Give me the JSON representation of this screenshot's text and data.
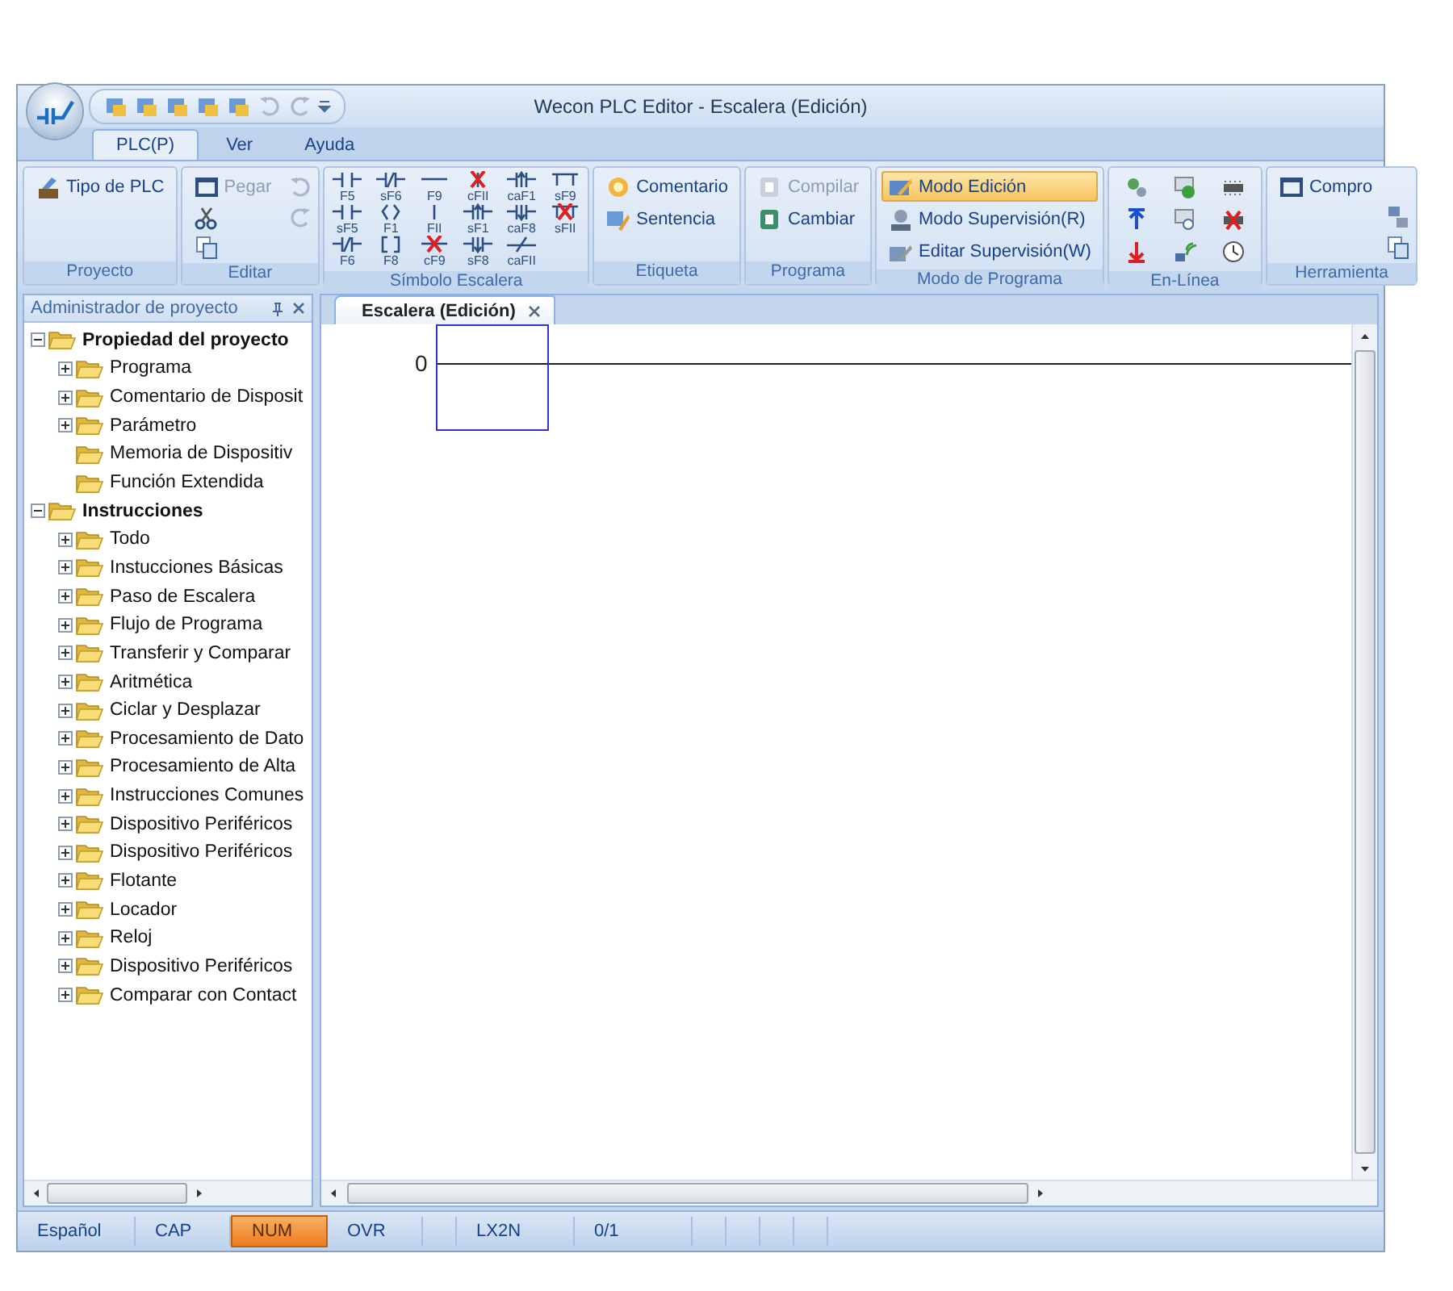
{
  "window": {
    "title": "Wecon PLC Editor - Escalera (Edición)"
  },
  "ribbon_tabs": [
    {
      "label": "PLC(P)",
      "selected": true
    },
    {
      "label": "Ver",
      "selected": false
    },
    {
      "label": "Ayuda",
      "selected": false
    }
  ],
  "ribbon_groups": [
    {
      "title": "Proyecto",
      "kind": "buttons",
      "items": [
        {
          "label": "Tipo de PLC",
          "disabled": false,
          "selected": false
        }
      ]
    },
    {
      "title": "Editar",
      "kind": "edit",
      "items": [
        {
          "label": "Pegar",
          "disabled": true,
          "selected": false
        }
      ]
    },
    {
      "title": "Símbolo Escalera",
      "kind": "symbols",
      "symbols": [
        {
          "key": "F5",
          "kind": "contact",
          "deleted": false
        },
        {
          "key": "sF6",
          "kind": "negated",
          "deleted": false
        },
        {
          "key": "F9",
          "kind": "hline",
          "deleted": false
        },
        {
          "key": "cFII",
          "kind": "vline",
          "deleted": true
        },
        {
          "key": "caF1",
          "kind": "rising",
          "deleted": false
        },
        {
          "key": "sF9",
          "kind": "instruction",
          "deleted": false
        },
        {
          "key": "sF5",
          "kind": "contact",
          "deleted": false
        },
        {
          "key": "F1",
          "kind": "coil",
          "deleted": false
        },
        {
          "key": "FII",
          "kind": "vline",
          "deleted": false
        },
        {
          "key": "sF1",
          "kind": "rising",
          "deleted": false
        },
        {
          "key": "caF8",
          "kind": "falling",
          "deleted": false
        },
        {
          "key": "sFII",
          "kind": "instruction",
          "deleted": true
        },
        {
          "key": "F6",
          "kind": "negated",
          "deleted": false
        },
        {
          "key": "F8",
          "kind": "function",
          "deleted": false
        },
        {
          "key": "cF9",
          "kind": "hline",
          "deleted": true
        },
        {
          "key": "sF8",
          "kind": "falling",
          "deleted": false
        },
        {
          "key": "caFII",
          "kind": "invert",
          "deleted": false
        }
      ]
    },
    {
      "title": "Etiqueta",
      "kind": "buttons",
      "items": [
        {
          "label": "Comentario",
          "disabled": false,
          "selected": false
        },
        {
          "label": "Sentencia",
          "disabled": false,
          "selected": false
        }
      ]
    },
    {
      "title": "Programa",
      "kind": "buttons",
      "items": [
        {
          "label": "Compilar",
          "disabled": true,
          "selected": false
        },
        {
          "label": "Cambiar",
          "disabled": false,
          "selected": false
        }
      ]
    },
    {
      "title": "Modo de Programa",
      "kind": "buttons",
      "items": [
        {
          "label": "Modo Edición",
          "disabled": false,
          "selected": true
        },
        {
          "label": "Modo Supervisión(R)",
          "disabled": false,
          "selected": false
        },
        {
          "label": "Editar Supervisión(W)",
          "disabled": false,
          "selected": false
        }
      ]
    },
    {
      "title": "En-Línea",
      "kind": "online"
    },
    {
      "title": "Herramienta",
      "kind": "buttons",
      "items": [
        {
          "label": "Compro",
          "disabled": false,
          "selected": false
        }
      ]
    }
  ],
  "project_panel": {
    "title": "Administrador de proyecto",
    "tree": [
      {
        "label": "Propiedad del proyecto",
        "kind": "expanded",
        "children": [
          {
            "label": "Programa",
            "kind": "collapsed"
          },
          {
            "label": "Comentario de Disposit",
            "kind": "collapsed"
          },
          {
            "label": "Parámetro",
            "kind": "collapsed"
          },
          {
            "label": "Memoria de Dispositiv",
            "kind": "leaf"
          },
          {
            "label": "Función Extendida",
            "kind": "leaf"
          }
        ]
      },
      {
        "label": "Instrucciones",
        "kind": "expanded",
        "children": [
          {
            "label": "Todo",
            "kind": "collapsed"
          },
          {
            "label": "Instucciones Básicas",
            "kind": "collapsed"
          },
          {
            "label": "Paso de Escalera",
            "kind": "collapsed"
          },
          {
            "label": "Flujo de Programa",
            "kind": "collapsed"
          },
          {
            "label": "Transferir y Comparar",
            "kind": "collapsed"
          },
          {
            "label": "Aritmética",
            "kind": "collapsed"
          },
          {
            "label": "Ciclar y Desplazar",
            "kind": "collapsed"
          },
          {
            "label": "Procesamiento de Dato",
            "kind": "collapsed"
          },
          {
            "label": "Procesamiento de Alta",
            "kind": "collapsed"
          },
          {
            "label": "Instrucciones Comunes",
            "kind": "collapsed"
          },
          {
            "label": "Dispositivo Periféricos",
            "kind": "collapsed"
          },
          {
            "label": "Dispositivo Periféricos",
            "kind": "collapsed"
          },
          {
            "label": "Flotante",
            "kind": "collapsed"
          },
          {
            "label": "Locador",
            "kind": "collapsed"
          },
          {
            "label": "Reloj",
            "kind": "collapsed"
          },
          {
            "label": "Dispositivo Periféricos",
            "kind": "collapsed"
          },
          {
            "label": "Comparar con Contact",
            "kind": "collapsed"
          }
        ]
      }
    ]
  },
  "editor": {
    "tabs": [
      {
        "label": "Escalera (Edición)",
        "selected": true
      }
    ],
    "rungs": [
      {
        "step": "0"
      }
    ]
  },
  "status_bar": [
    {
      "kind": "text",
      "text": "Español"
    },
    {
      "kind": "indicator",
      "text": "CAP",
      "on": false
    },
    {
      "kind": "indicator",
      "text": "NUM",
      "on": true
    },
    {
      "kind": "indicator",
      "text": "OVR",
      "on": false
    },
    {
      "kind": "blank"
    },
    {
      "kind": "text",
      "text": "LX2N"
    },
    {
      "kind": "text",
      "text": "0/1"
    },
    {
      "kind": "blank"
    },
    {
      "kind": "blank"
    },
    {
      "kind": "blank"
    },
    {
      "kind": "blank"
    }
  ]
}
